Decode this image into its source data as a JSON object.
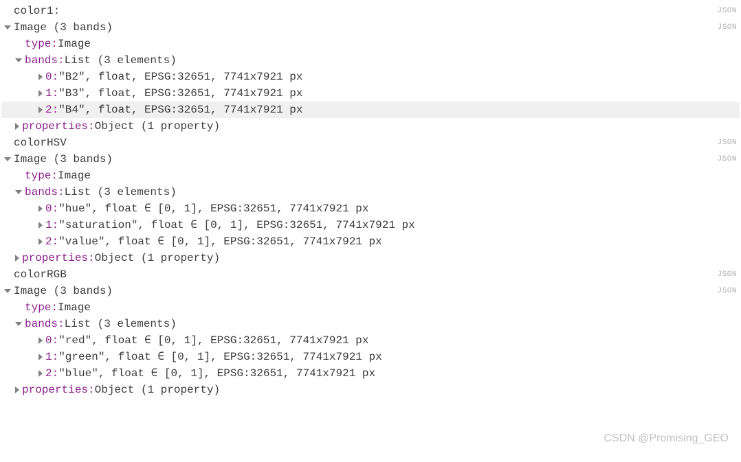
{
  "jsonTag": "JSON",
  "watermark": "CSDN @Promising_GEO",
  "sections": [
    {
      "title": "color1:",
      "header": "Image (3 bands)",
      "typeKey": "type:",
      "typeVal": "Image",
      "bandsKey": "bands:",
      "bandsVal": "List (3 elements)",
      "items": [
        {
          "key": "0:",
          "val": "\"B2\", float, EPSG:32651, 7741x7921 px",
          "hover": false
        },
        {
          "key": "1:",
          "val": "\"B3\", float, EPSG:32651, 7741x7921 px",
          "hover": false
        },
        {
          "key": "2:",
          "val": "\"B4\", float, EPSG:32651, 7741x7921 px",
          "hover": true
        }
      ],
      "propsKey": "properties:",
      "propsVal": "Object (1 property)"
    },
    {
      "title": "colorHSV",
      "header": "Image (3 bands)",
      "typeKey": "type:",
      "typeVal": "Image",
      "bandsKey": "bands:",
      "bandsVal": "List (3 elements)",
      "items": [
        {
          "key": "0:",
          "val": "\"hue\", float ∈ [0, 1], EPSG:32651, 7741x7921 px",
          "hover": false
        },
        {
          "key": "1:",
          "val": "\"saturation\", float ∈ [0, 1], EPSG:32651, 7741x7921 px",
          "hover": false
        },
        {
          "key": "2:",
          "val": "\"value\", float ∈ [0, 1], EPSG:32651, 7741x7921 px",
          "hover": false
        }
      ],
      "propsKey": "properties:",
      "propsVal": "Object (1 property)"
    },
    {
      "title": "colorRGB",
      "header": "Image (3 bands)",
      "typeKey": "type:",
      "typeVal": "Image",
      "bandsKey": "bands:",
      "bandsVal": "List (3 elements)",
      "items": [
        {
          "key": "0:",
          "val": "\"red\", float ∈ [0, 1], EPSG:32651, 7741x7921 px",
          "hover": false
        },
        {
          "key": "1:",
          "val": "\"green\", float ∈ [0, 1], EPSG:32651, 7741x7921 px",
          "hover": false
        },
        {
          "key": "2:",
          "val": "\"blue\", float ∈ [0, 1], EPSG:32651, 7741x7921 px",
          "hover": false
        }
      ],
      "propsKey": "properties:",
      "propsVal": "Object (1 property)"
    }
  ]
}
